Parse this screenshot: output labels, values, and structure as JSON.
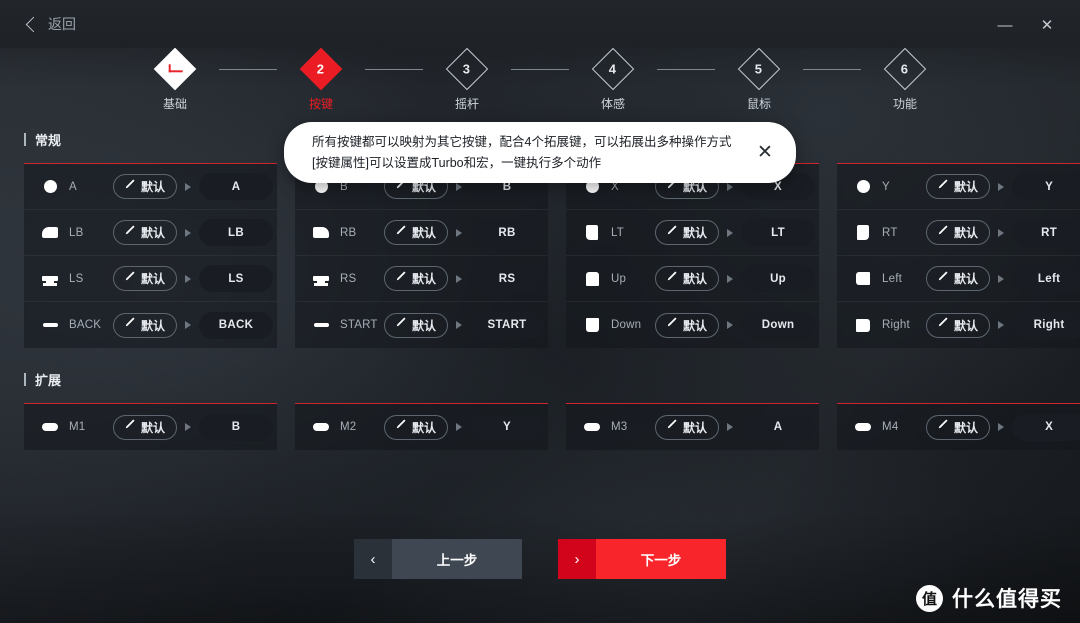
{
  "titlebar": {
    "back_label": "返回",
    "minimize_glyph": "—",
    "close_glyph": "✕"
  },
  "stepper": {
    "steps": [
      {
        "num": "✓",
        "label": "基础",
        "state": "done"
      },
      {
        "num": "2",
        "label": "按键",
        "state": "current"
      },
      {
        "num": "3",
        "label": "摇杆",
        "state": "todo"
      },
      {
        "num": "4",
        "label": "体感",
        "state": "todo"
      },
      {
        "num": "5",
        "label": "鼠标",
        "state": "todo"
      },
      {
        "num": "6",
        "label": "功能",
        "state": "todo"
      }
    ]
  },
  "tooltip": {
    "line1": "所有按键都可以映射为其它按键，配合4个拓展键，可以拓展出多种操作方式",
    "line2": "[按键属性]可以设置成Turbo和宏，一键执行多个动作",
    "close_glyph": "✕"
  },
  "sections": [
    {
      "title": "常规",
      "columns": [
        {
          "rows": [
            {
              "icon": "circle-button-icon",
              "key": "A",
              "mode": "默认",
              "mapped": "A"
            },
            {
              "icon": "bumper-left-icon",
              "key": "LB",
              "mode": "默认",
              "mapped": "LB"
            },
            {
              "icon": "stick-left-icon",
              "key": "LS",
              "mode": "默认",
              "mapped": "LS"
            },
            {
              "icon": "bar-button-icon",
              "key": "BACK",
              "mode": "默认",
              "mapped": "BACK"
            }
          ]
        },
        {
          "rows": [
            {
              "icon": "circle-button-icon",
              "key": "B",
              "mode": "默认",
              "mapped": "B"
            },
            {
              "icon": "bumper-right-icon",
              "key": "RB",
              "mode": "默认",
              "mapped": "RB"
            },
            {
              "icon": "stick-right-icon",
              "key": "RS",
              "mode": "默认",
              "mapped": "RS"
            },
            {
              "icon": "bar-button-icon",
              "key": "START",
              "mode": "默认",
              "mapped": "START"
            }
          ]
        },
        {
          "rows": [
            {
              "icon": "circle-button-icon",
              "key": "X",
              "mode": "默认",
              "mapped": "X"
            },
            {
              "icon": "trigger-left-icon",
              "key": "LT",
              "mode": "默认",
              "mapped": "LT"
            },
            {
              "icon": "dpad-up-icon",
              "key": "Up",
              "mode": "默认",
              "mapped": "Up"
            },
            {
              "icon": "dpad-down-icon",
              "key": "Down",
              "mode": "默认",
              "mapped": "Down"
            }
          ]
        },
        {
          "rows": [
            {
              "icon": "circle-button-icon",
              "key": "Y",
              "mode": "默认",
              "mapped": "Y"
            },
            {
              "icon": "trigger-right-icon",
              "key": "RT",
              "mode": "默认",
              "mapped": "RT"
            },
            {
              "icon": "dpad-left-icon",
              "key": "Left",
              "mode": "默认",
              "mapped": "Left"
            },
            {
              "icon": "dpad-right-icon",
              "key": "Right",
              "mode": "默认",
              "mapped": "Right"
            }
          ]
        }
      ]
    },
    {
      "title": "扩展",
      "columns": [
        {
          "rows": [
            {
              "icon": "paddle-icon",
              "key": "M1",
              "mode": "默认",
              "mapped": "B"
            }
          ]
        },
        {
          "rows": [
            {
              "icon": "paddle-icon",
              "key": "M2",
              "mode": "默认",
              "mapped": "Y"
            }
          ]
        },
        {
          "rows": [
            {
              "icon": "paddle-icon",
              "key": "M3",
              "mode": "默认",
              "mapped": "A"
            }
          ]
        },
        {
          "rows": [
            {
              "icon": "paddle-icon",
              "key": "M4",
              "mode": "默认",
              "mapped": "X"
            }
          ]
        }
      ]
    }
  ],
  "footer": {
    "prev_label": "上一步",
    "prev_glyph": "‹",
    "next_label": "下一步",
    "next_glyph": "›"
  },
  "watermark": {
    "logo_char": "值",
    "text": "什么值得买"
  },
  "colors": {
    "accent_red": "#ec1c24",
    "next_button_red": "#f8262b",
    "card_border_red": "#d0252c"
  }
}
